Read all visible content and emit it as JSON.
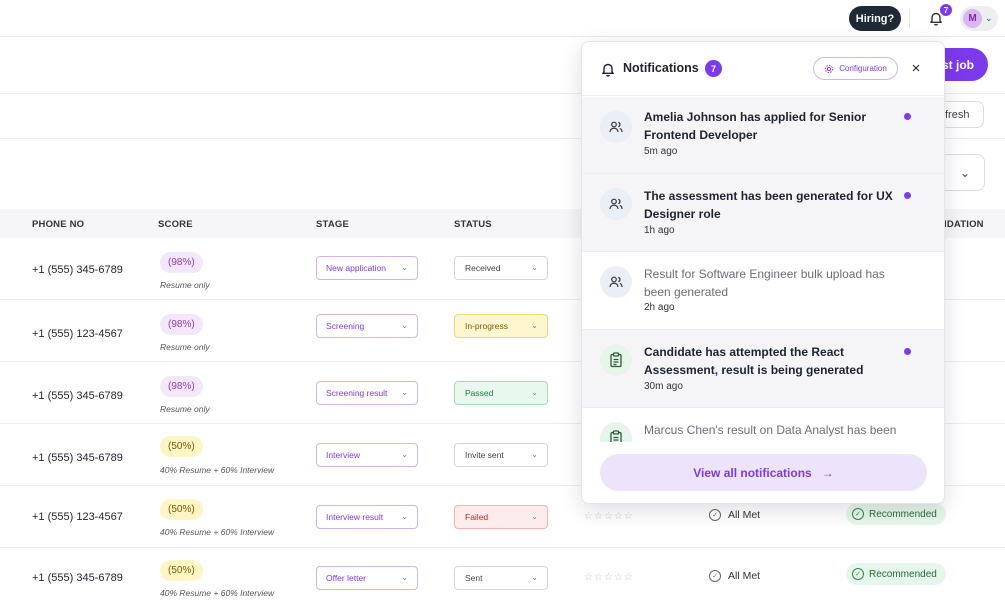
{
  "header": {
    "hiring_label": "Hiring?",
    "notification_badge": "7",
    "avatar_initial": "M"
  },
  "actions": {
    "post_job_partial": "st job",
    "refresh_partial": "fresh"
  },
  "table": {
    "columns": {
      "phone": "PHONE NO",
      "score": "SCORE",
      "stage": "STAGE",
      "status": "STATUS",
      "recommendation_partial": "IDATION"
    },
    "rows": [
      {
        "phone": "+1 (555) 345-6789",
        "score": "(98%)",
        "score_note": "Resume only",
        "stage": "New application",
        "status": "Received",
        "stars": "☆☆☆☆☆",
        "criteria": "",
        "recommendation": ""
      },
      {
        "phone": "+1 (555) 123-4567",
        "score": "(98%)",
        "score_note": "Resume only",
        "stage": "Screening",
        "status": "In-progress",
        "stars": "☆☆☆☆☆",
        "criteria": "",
        "recommendation": ""
      },
      {
        "phone": "+1 (555) 345-6789",
        "score": "(98%)",
        "score_note": "Resume only",
        "stage": "Screening result",
        "status": "Passed",
        "stars": "☆☆☆☆☆",
        "criteria": "",
        "recommendation": ""
      },
      {
        "phone": "+1 (555) 345-6789",
        "score": "(50%)",
        "score_note": "40% Resume + 60% Interview",
        "stage": "Interview",
        "status": "Invite sent",
        "stars": "☆☆☆☆☆",
        "criteria": "",
        "recommendation": ""
      },
      {
        "phone": "+1 (555) 123-4567",
        "score": "(50%)",
        "score_note": "40% Resume + 60% Interview",
        "stage": "Interview result",
        "status": "Failed",
        "stars": "☆☆☆☆☆",
        "criteria": "All Met",
        "recommendation": "Recommended"
      },
      {
        "phone": "+1 (555) 345-6789",
        "score": "(50%)",
        "score_note": "40% Resume + 60% Interview",
        "stage": "Offer letter",
        "status": "Sent",
        "stars": "☆☆☆☆☆",
        "criteria": "All Met",
        "recommendation": "Recommended"
      }
    ]
  },
  "notifications": {
    "title": "Notifications",
    "count": "7",
    "config_label": "Configuration",
    "close_glyph": "×",
    "items": [
      {
        "text": "Amelia Johnson has applied for Senior Frontend Developer",
        "time": "5m ago",
        "icon": "people-icon",
        "unread": true
      },
      {
        "text": "The assessment has been generated for UX Designer role",
        "time": "1h ago",
        "icon": "people-icon",
        "unread": true
      },
      {
        "text": "Result for Software Engineer bulk upload has been generated",
        "time": "2h ago",
        "icon": "people-icon",
        "unread": false
      },
      {
        "text": "Candidate has attempted the React Assessment, result is being generated",
        "time": "30m ago",
        "icon": "clipboard-icon",
        "unread": true
      },
      {
        "text": "Marcus Chen's result on Data Analyst has been",
        "time": "",
        "icon": "clipboard-icon",
        "unread": false
      }
    ],
    "view_all_label": "View all notifications",
    "view_all_arrow": "→"
  },
  "colors": {
    "accent": "#7c3aed",
    "dark_button": "#1f2a36",
    "recommended_bg": "#e6f6ea"
  }
}
